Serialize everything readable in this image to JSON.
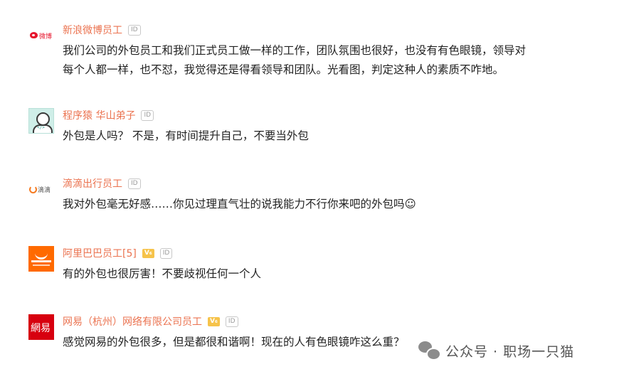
{
  "comments": [
    {
      "user": "新浪微博员工",
      "badge": "ID",
      "avatar_icon": "weibo-logo-icon",
      "avatar_text": "微博",
      "lines": [
        "我们公司的外包员工和我们正式员工做一样的工作，团队氛围也很好，也没有有色眼镜，领导对",
        "每个人都一样，也不怼，我觉得还是得看领导和团队。光看图，判定这种人的素质不咋地。"
      ]
    },
    {
      "user": "程序猿 华山弟子",
      "badge": "ID",
      "avatar_icon": "programmer-avatar-icon",
      "avatar_text": "</>",
      "lines": [
        "外包是人吗？ 不是，有时间提升自己，不要当外包"
      ]
    },
    {
      "user": "滴滴出行员工",
      "badge": "ID",
      "avatar_icon": "didi-logo-icon",
      "avatar_text": "滴滴",
      "lines": [
        "我对外包毫无好感……你见过理直气壮的说我能力不行你来吧的外包吗☺"
      ]
    },
    {
      "user": "阿里巴巴员工[5]",
      "badge": "ID",
      "vip": "V₆",
      "avatar_icon": "alibaba-logo-icon",
      "lines": [
        "有的外包也很厉害！不要歧视任何一个人"
      ]
    },
    {
      "user": "网易（杭州）网络有限公司员工",
      "badge": "ID",
      "vip": "V₆",
      "avatar_icon": "netease-logo-icon",
      "avatar_text": "網易",
      "lines": [
        "感觉网易的外包很多，但是都很和谐啊！现在的人有色眼镜咋这么重？"
      ]
    }
  ],
  "watermark": {
    "icon": "wechat-icon",
    "text": "公众号 · 职场一只猫"
  },
  "colors": {
    "username": "#eb7350",
    "body_text": "#222222",
    "vip": "#f6c34a"
  }
}
